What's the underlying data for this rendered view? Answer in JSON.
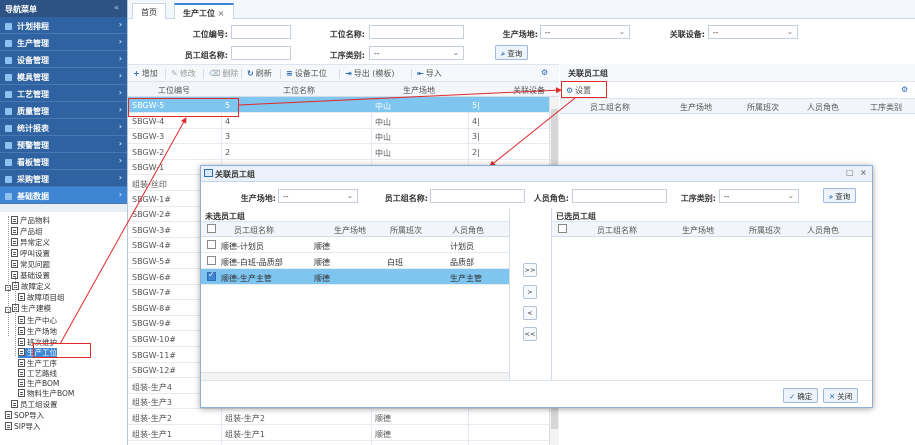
{
  "sidebar": {
    "title": "导航菜单",
    "collapse_glyph": "«",
    "menu": [
      {
        "label": "计划排程",
        "icon": "calendar-icon"
      },
      {
        "label": "生产管理",
        "icon": "gear-icon"
      },
      {
        "label": "设备管理",
        "icon": "device-icon"
      },
      {
        "label": "模具管理",
        "icon": "mold-icon"
      },
      {
        "label": "工艺管理",
        "icon": "process-icon"
      },
      {
        "label": "质量管理",
        "icon": "quality-icon"
      },
      {
        "label": "统计报表",
        "icon": "chart-icon"
      },
      {
        "label": "预警管理",
        "icon": "alert-icon"
      },
      {
        "label": "看板管理",
        "icon": "board-icon"
      },
      {
        "label": "采购管理",
        "icon": "cart-icon"
      },
      {
        "label": "基础数据",
        "icon": "database-icon"
      }
    ],
    "tree": [
      "产品物料",
      "产品组",
      "异常定义",
      "呼叫设置",
      "常见问题",
      "基础设置",
      "故障定义",
      "故障项目组",
      "生产建模",
      "生产中心",
      "生产场地",
      "班次维护",
      "生产工位",
      "生产工序",
      "工艺路线",
      "生产BOM",
      "物料生产BOM",
      "员工组设置",
      "SOP导入",
      "SIP导入"
    ],
    "expand_minus": "-"
  },
  "tabs": [
    {
      "label": "首页"
    },
    {
      "label": "生产工位",
      "close": "×"
    }
  ],
  "filters": {
    "station_code": {
      "label": "工位编号:",
      "value": ""
    },
    "station_name": {
      "label": "工位名称:",
      "value": ""
    },
    "production_site": {
      "label": "生产场地:",
      "value": "--"
    },
    "related_device": {
      "label": "关联设备:",
      "value": "--"
    },
    "employee_group": {
      "label": "员工组名称:",
      "value": ""
    },
    "process_type": {
      "label": "工序类别:",
      "value": "--"
    },
    "query_button": "查询"
  },
  "toolbar": {
    "add": "增加",
    "edit": "修改",
    "delete": "删除",
    "refresh": "刷新",
    "device_station": "设备工位",
    "export": "导出 (模板)",
    "import": "导入"
  },
  "grid": {
    "headers": [
      "工位编号",
      "工位名称",
      "生产场地",
      "关联设备"
    ],
    "rows": [
      {
        "code": "SBGW-5",
        "name": "5",
        "site": "中山",
        "device": "5|"
      },
      {
        "code": "SBGW-4",
        "name": "4",
        "site": "中山",
        "device": "4|"
      },
      {
        "code": "SBGW-3",
        "name": "3",
        "site": "中山",
        "device": "3|"
      },
      {
        "code": "SBGW-2",
        "name": "2",
        "site": "中山",
        "device": "2|"
      },
      {
        "code": "SBGW-1",
        "name": "",
        "site": "",
        "device": ""
      },
      {
        "code": "组装-丝印",
        "name": "",
        "site": "",
        "device": ""
      },
      {
        "code": "SBGW-1#",
        "name": "",
        "site": "",
        "device": ""
      },
      {
        "code": "SBGW-2#",
        "name": "",
        "site": "",
        "device": ""
      },
      {
        "code": "SBGW-3#",
        "name": "",
        "site": "",
        "device": ""
      },
      {
        "code": "SBGW-4#",
        "name": "",
        "site": "",
        "device": ""
      },
      {
        "code": "SBGW-5#",
        "name": "",
        "site": "",
        "device": ""
      },
      {
        "code": "SBGW-6#",
        "name": "",
        "site": "",
        "device": ""
      },
      {
        "code": "SBGW-7#",
        "name": "",
        "site": "",
        "device": ""
      },
      {
        "code": "SBGW-8#",
        "name": "",
        "site": "",
        "device": ""
      },
      {
        "code": "SBGW-9#",
        "name": "",
        "site": "",
        "device": ""
      },
      {
        "code": "SBGW-10#",
        "name": "",
        "site": "",
        "device": ""
      },
      {
        "code": "SBGW-11#",
        "name": "",
        "site": "",
        "device": ""
      },
      {
        "code": "SBGW-12#",
        "name": "",
        "site": "",
        "device": ""
      },
      {
        "code": "组装-生产4",
        "name": "",
        "site": "",
        "device": ""
      },
      {
        "code": "组装-生产3",
        "name": "",
        "site": "",
        "device": ""
      },
      {
        "code": "组装-生产2",
        "name": "组装-生产2",
        "site": "顺德",
        "device": ""
      },
      {
        "code": "组装-生产1",
        "name": "组装-生产1",
        "site": "顺德",
        "device": ""
      }
    ]
  },
  "right_panel": {
    "title": "关联员工组",
    "settings_button": "设置",
    "headers": [
      "员工组名称",
      "生产场地",
      "所属班次",
      "人员角色",
      "工序类别"
    ]
  },
  "dialog": {
    "title": "关联员工组",
    "filters": {
      "site": {
        "label": "生产场地:",
        "value": "--"
      },
      "group": {
        "label": "员工组名称:",
        "value": ""
      },
      "role": {
        "label": "人员角色:",
        "value": ""
      },
      "process": {
        "label": "工序类别:",
        "value": "--"
      },
      "query_button": "查询"
    },
    "left": {
      "title": "未选员工组",
      "headers": [
        "员工组名称",
        "生产场地",
        "所属班次",
        "人员角色"
      ],
      "rows": [
        {
          "name": "顺德-计划员",
          "site": "顺德",
          "shift": "",
          "role": "计划员",
          "checked": false
        },
        {
          "name": "顺德-白班-品质部",
          "site": "顺德",
          "shift": "白班",
          "role": "品质部",
          "checked": false
        },
        {
          "name": "顺德-生产主管",
          "site": "顺德",
          "shift": "",
          "role": "生产主管",
          "checked": true
        }
      ]
    },
    "move_buttons": [
      ">>",
      ">",
      "<",
      "<<"
    ],
    "right": {
      "title": "已选员工组",
      "headers": [
        "员工组名称",
        "生产场地",
        "所属班次",
        "人员角色"
      ]
    },
    "ok_button": "确定",
    "close_button": "关闭",
    "window_controls": {
      "maximize": "□",
      "close": "×"
    }
  },
  "colors": {
    "selected_row": "#7ec5f0",
    "nav_blue": "#2f62a0",
    "annotation_red": "#e12a2a"
  }
}
